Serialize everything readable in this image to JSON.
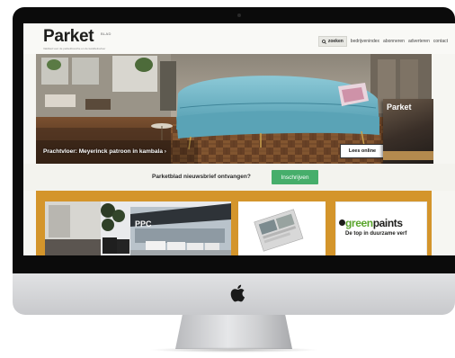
{
  "site": {
    "logo": "Parket",
    "logo_sup": "BLAD",
    "tagline": "Vakblad voor de parketbranche en de kwaliteitsvloer"
  },
  "nav": {
    "search_label": "zoeken",
    "links": [
      "bedrijvenindex",
      "abonneren",
      "adverteren",
      "contact"
    ]
  },
  "hero": {
    "caption": "Prachtvloer: Meyerinck patroon in kambala",
    "caption_arrow": "›",
    "read_online": "Lees online",
    "magazine_title": "Parket"
  },
  "newsletter": {
    "label": "Parketblad nieuwsbrief ontvangen?",
    "button": "Inschrijven"
  },
  "ads": {
    "ppc_label": "PPC",
    "greenpaints_brand_green": "green",
    "greenpaints_brand_dark": "paints",
    "greenpaints_slogan": "De top in duurzame verf"
  },
  "colors": {
    "accent_green": "#46ae6b",
    "ads_band": "#d4952b",
    "sofa": "#6fb3c4",
    "bezel": "#0b0b0b"
  },
  "icons": {
    "search": "search-icon",
    "apple": "apple-logo-icon"
  }
}
